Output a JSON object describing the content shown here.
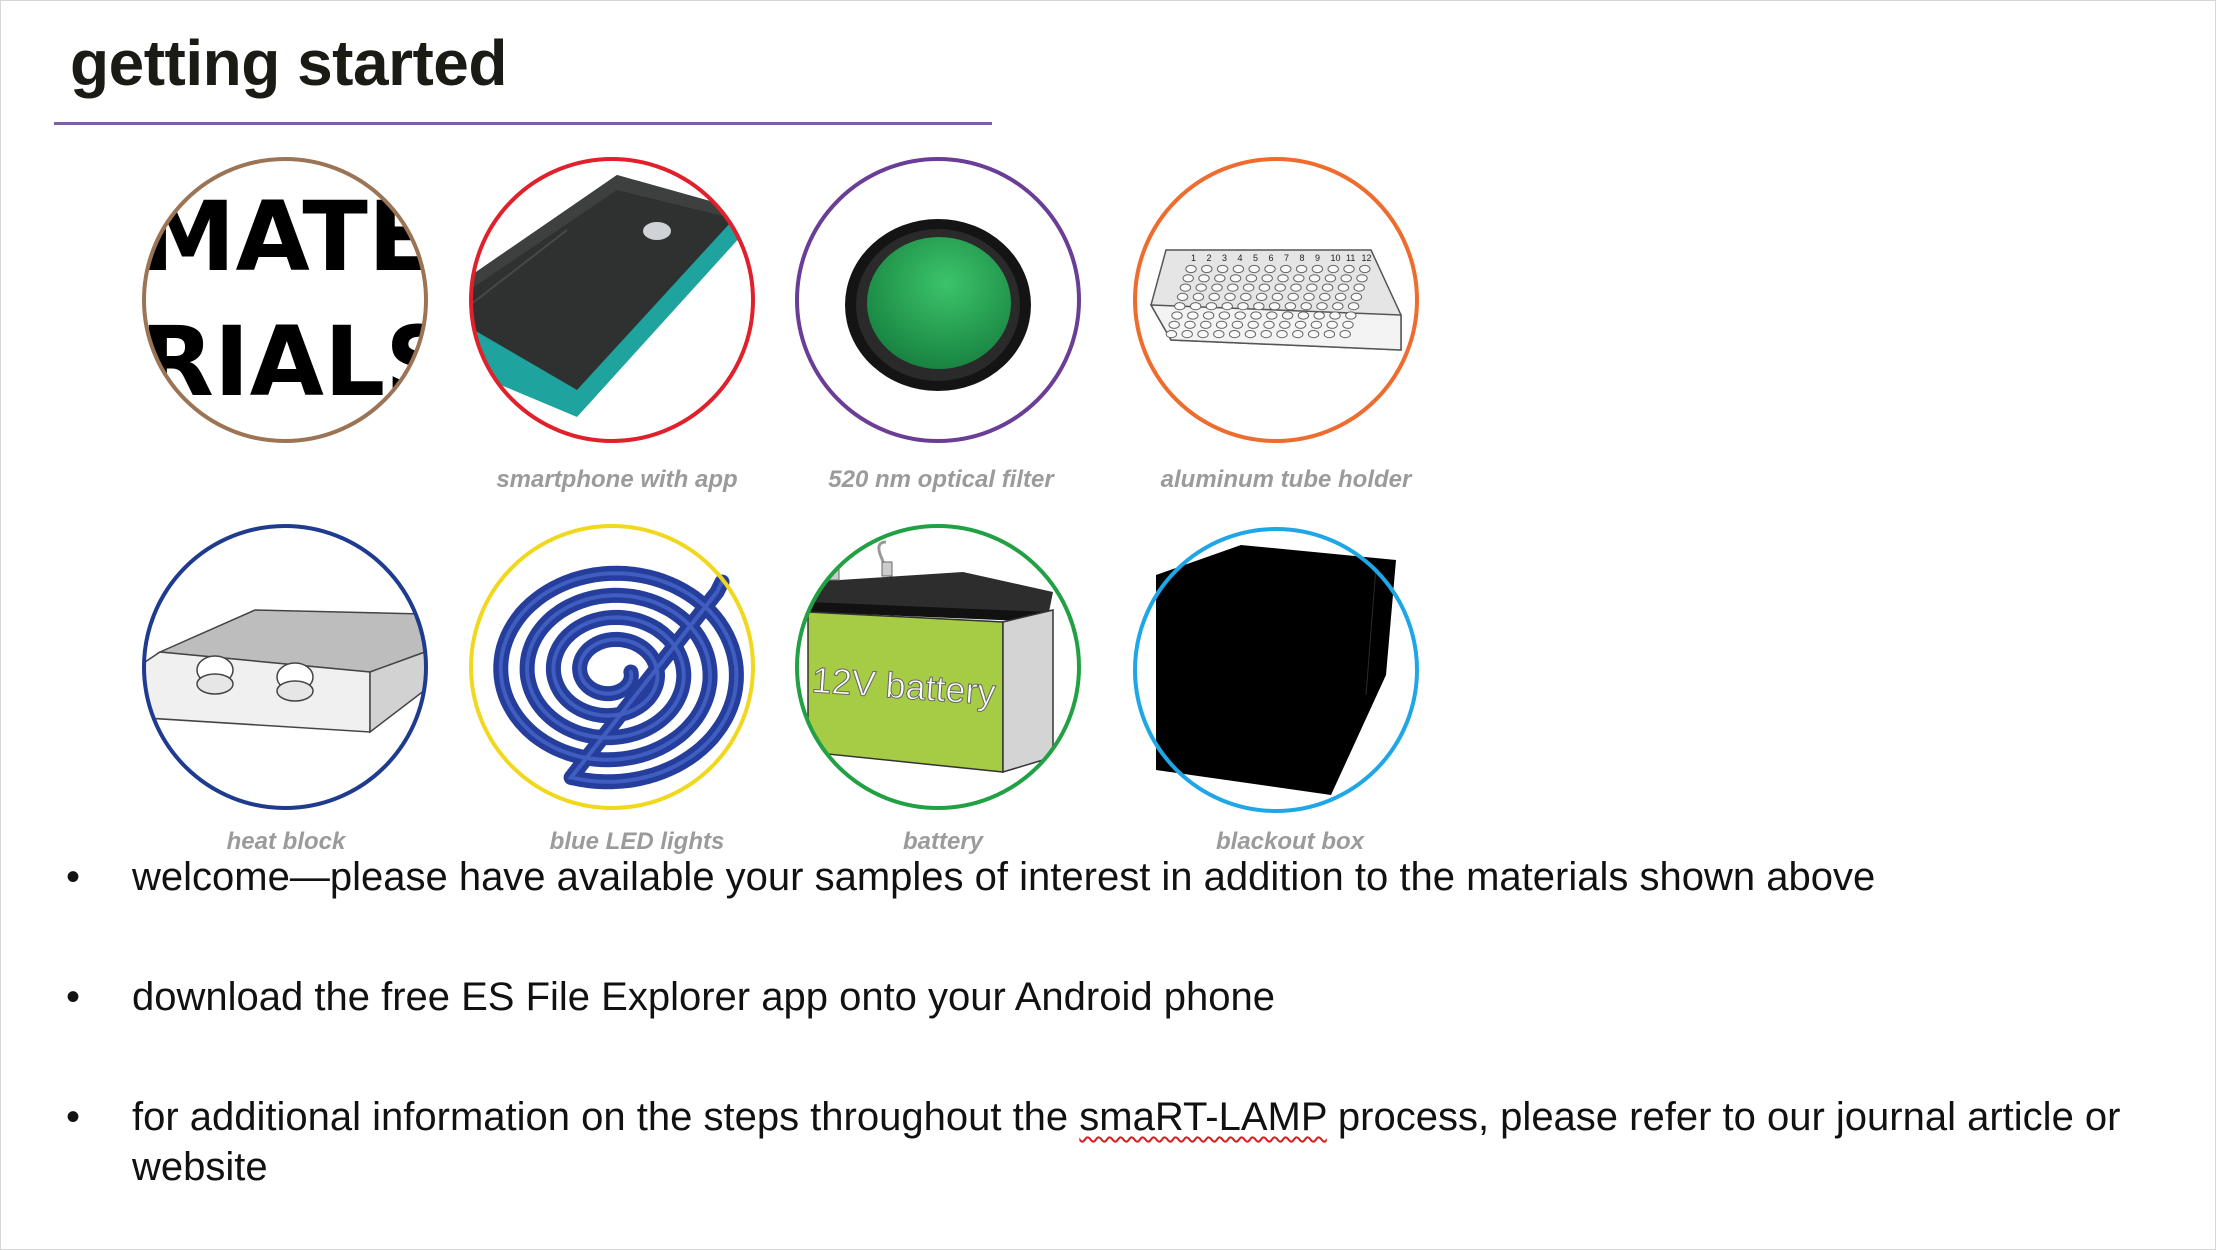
{
  "slide": {
    "title": "getting started",
    "accent_color": "#7d5fa6"
  },
  "materials": [
    {
      "id": "materials-title",
      "caption": "",
      "image_text": [
        "MATE",
        "RIALS"
      ],
      "ring_color": "#9b7455"
    },
    {
      "id": "smartphone",
      "caption": "smartphone with app",
      "ring_color": "#e0202a"
    },
    {
      "id": "optical-filter",
      "caption": "520 nm optical filter",
      "ring_color": "#6a3d96"
    },
    {
      "id": "tube-holder",
      "caption": "aluminum tube holder",
      "ring_color": "#ee6c2d",
      "plate_cols": [
        "1",
        "2",
        "3",
        "4",
        "5",
        "6",
        "7",
        "8",
        "9",
        "10",
        "11",
        "12"
      ]
    },
    {
      "id": "heat-block",
      "caption": "heat block",
      "ring_color": "#1f3b8f"
    },
    {
      "id": "led-lights",
      "caption": "blue LED lights",
      "ring_color": "#f1d81e"
    },
    {
      "id": "battery",
      "caption": "battery",
      "ring_color": "#22a044",
      "label": "12V battery"
    },
    {
      "id": "blackout-box",
      "caption": "blackout box",
      "ring_color": "#1ea6e6"
    }
  ],
  "bullets": {
    "symbol": "•",
    "items": [
      {
        "text": "welcome—please have available your samples of interest in addition to the materials shown above"
      },
      {
        "text": "download the free ES File Explorer app onto your Android phone"
      },
      {
        "before": "for additional information on the steps throughout the ",
        "flagged": "smaRT-LAMP",
        "after": " process, please refer to our journal article or website"
      }
    ]
  }
}
